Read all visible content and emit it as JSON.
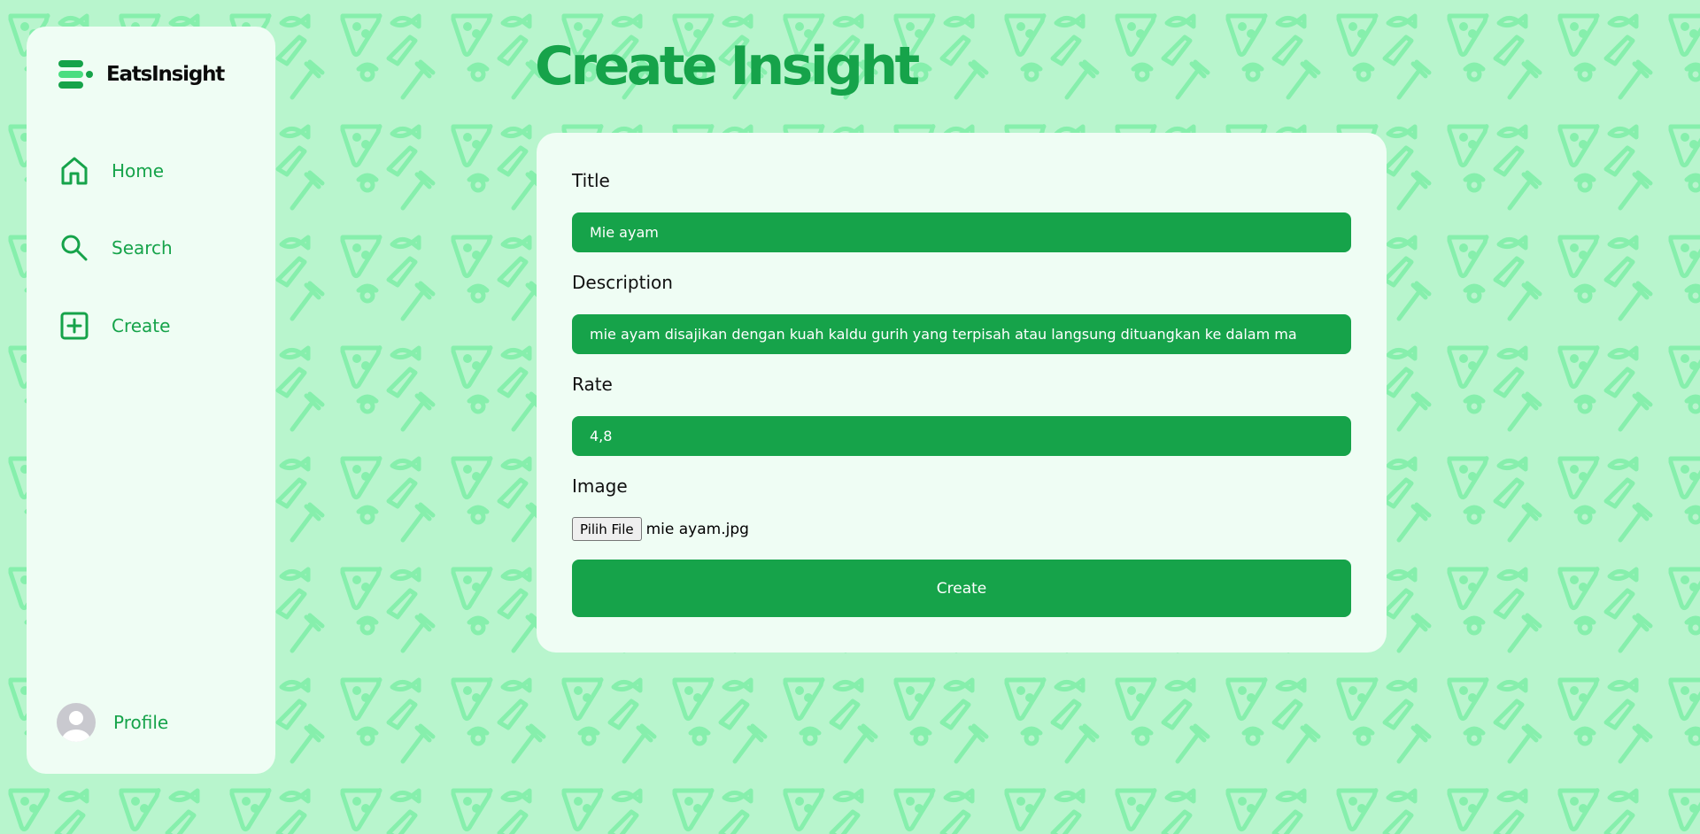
{
  "app": {
    "brand_name": "EatsInsight"
  },
  "colors": {
    "background": "#b8f5cd",
    "pattern": "#86efac",
    "accent": "#16a34a",
    "panel": "#effdf4"
  },
  "sidebar": {
    "items": [
      {
        "label": "Home",
        "icon": "home-icon"
      },
      {
        "label": "Search",
        "icon": "search-icon"
      },
      {
        "label": "Create",
        "icon": "plus-square-icon"
      }
    ],
    "profile": {
      "label": "Profile",
      "icon": "avatar-icon"
    }
  },
  "page": {
    "title": "Create Insight"
  },
  "form": {
    "title": {
      "label": "Title",
      "value": "Mie ayam"
    },
    "description": {
      "label": "Description",
      "value": "mie ayam disajikan dengan kuah kaldu gurih yang terpisah atau langsung dituangkan ke dalam ma"
    },
    "rate": {
      "label": "Rate",
      "value": "4,8"
    },
    "image": {
      "label": "Image",
      "button_label": "Pilih File",
      "file_name": "mie ayam.jpg"
    },
    "submit_label": "Create"
  },
  "background_icons": [
    "pizza-slice-icon",
    "fish-icon",
    "rice-bowl-icon",
    "knife-icon",
    "fork-icon"
  ]
}
